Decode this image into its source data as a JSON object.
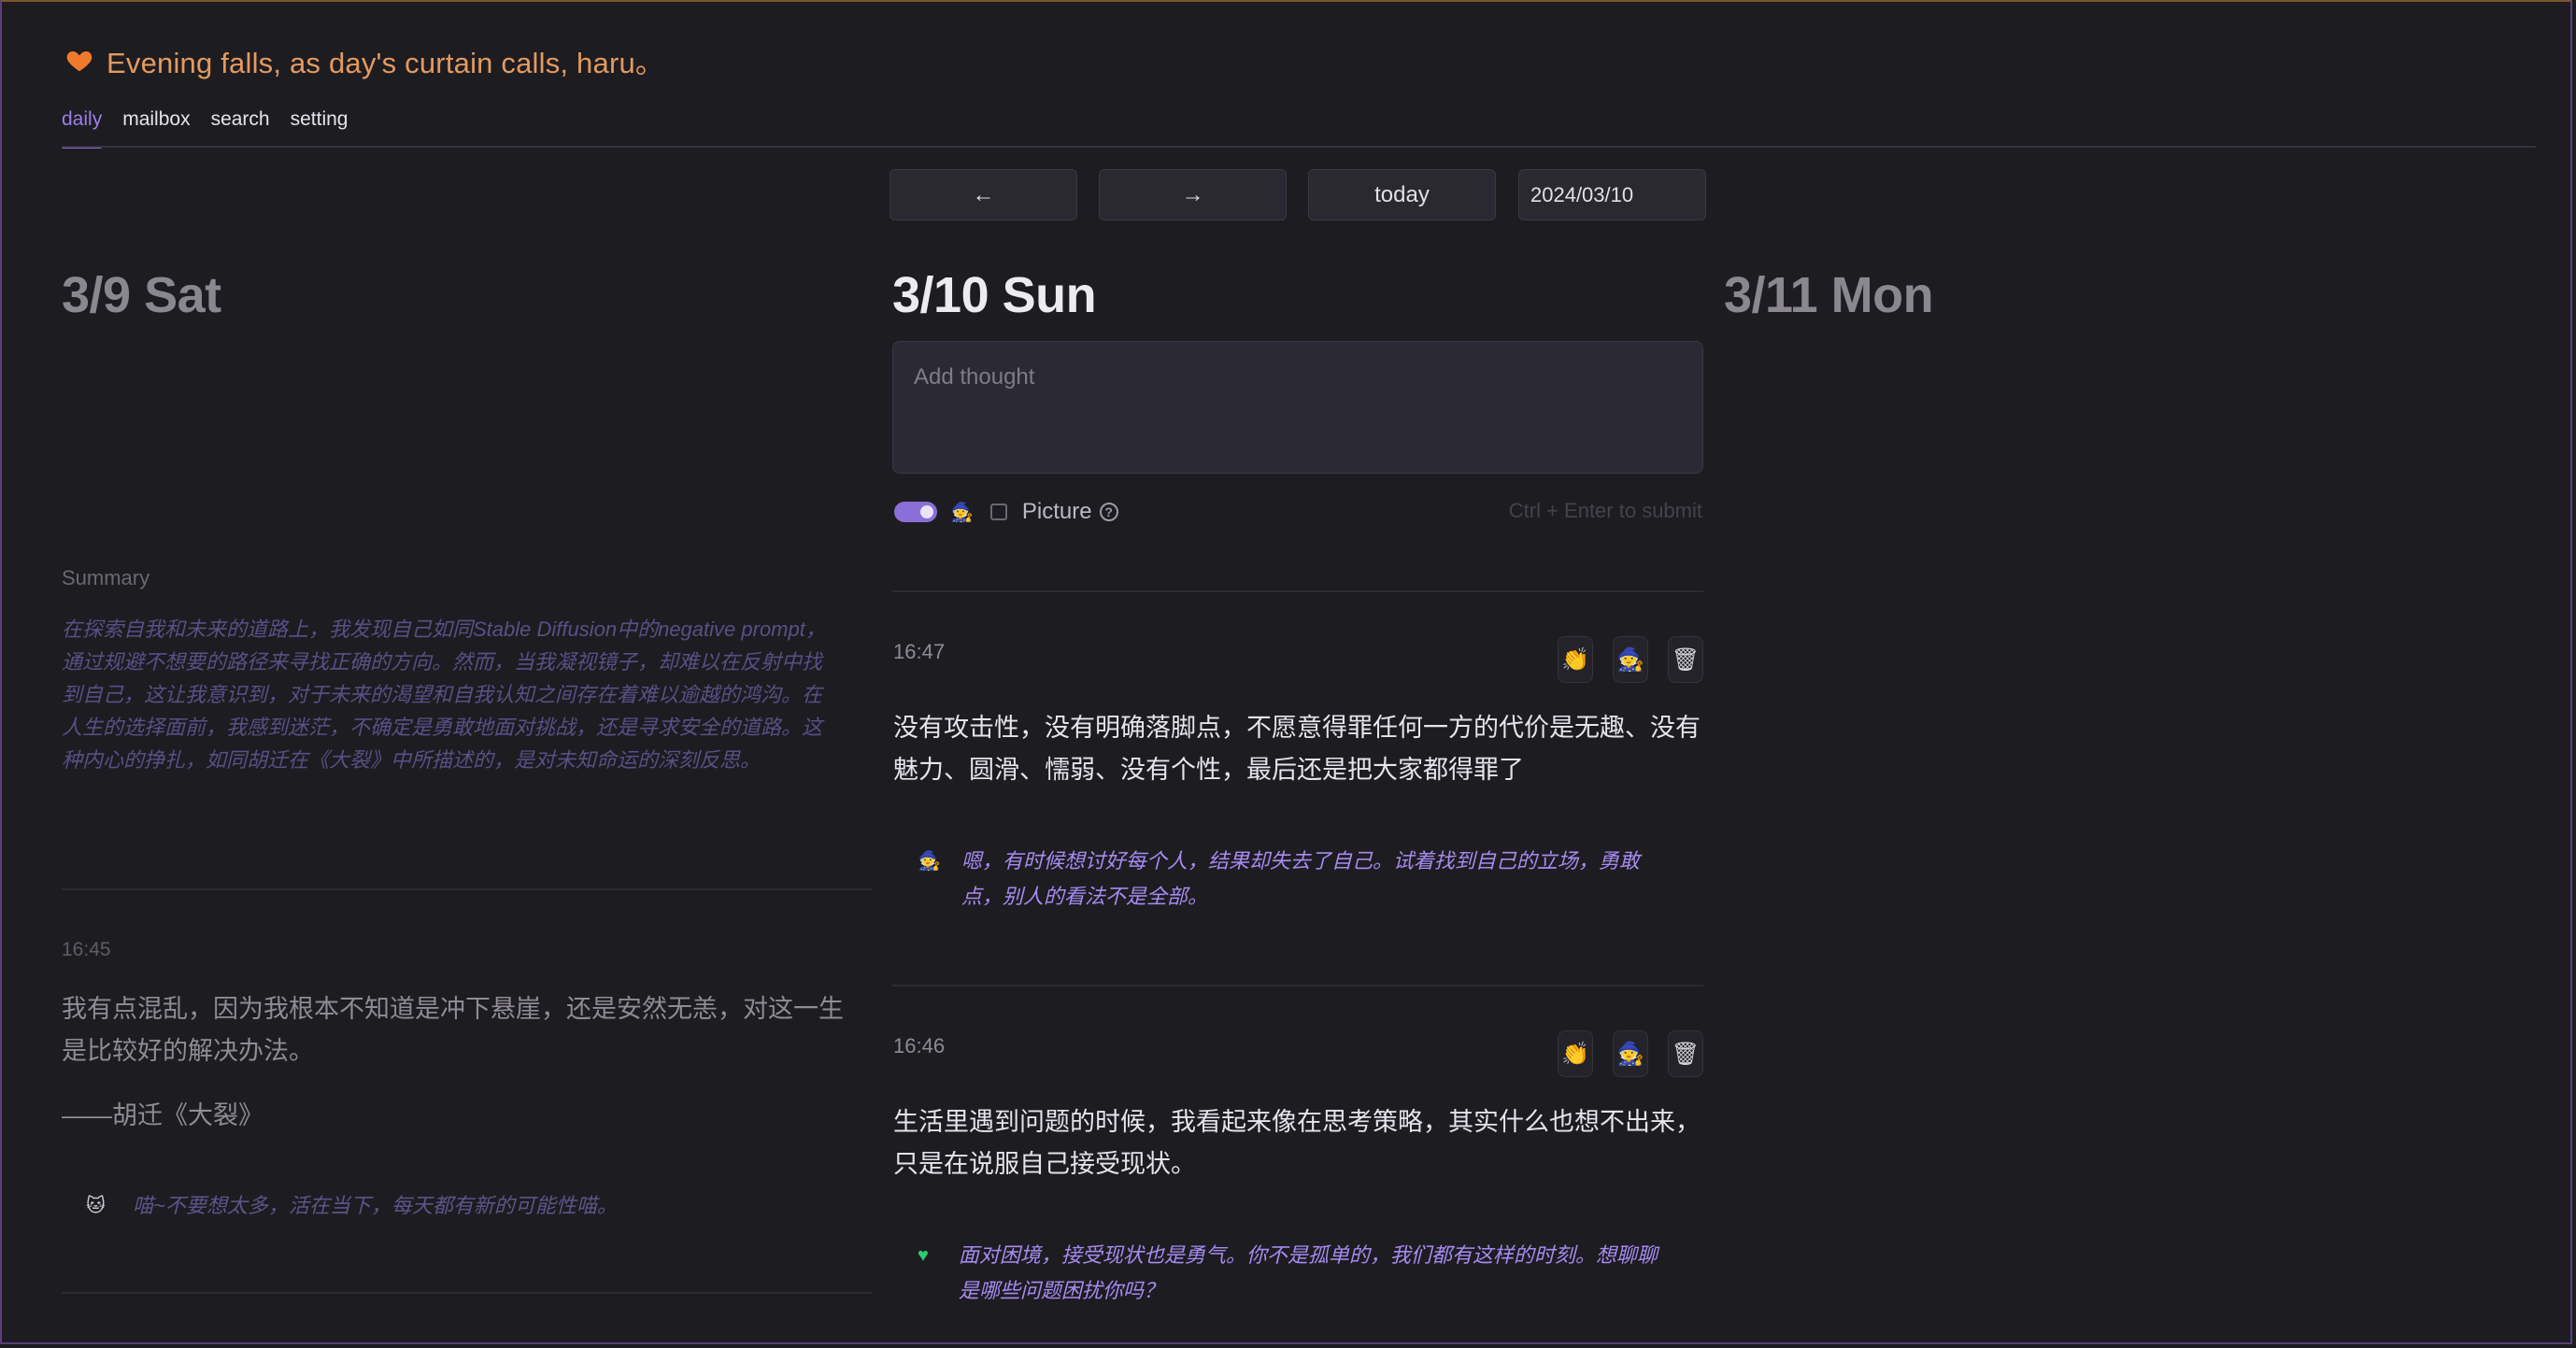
{
  "header": {
    "greeting": "Evening falls, as day's curtain calls, haru。",
    "icon": "heart-icon",
    "accent": "#e39a5e"
  },
  "tabs": [
    {
      "label": "daily",
      "active": true
    },
    {
      "label": "mailbox",
      "active": false
    },
    {
      "label": "search",
      "active": false
    },
    {
      "label": "setting",
      "active": false
    }
  ],
  "nav": {
    "prev": "←",
    "next": "→",
    "today": "today",
    "date_value": "2024/03/10"
  },
  "days": {
    "prev": {
      "title": "3/9 Sat",
      "summary_label": "Summary",
      "summary": "在探索自我和未来的道路上，我发现自己如同Stable Diffusion中的negative prompt，通过规避不想要的路径来寻找正确的方向。然而，当我凝视镜子，却难以在反射中找到自己，这让我意识到，对于未来的渴望和自我认知之间存在着难以逾越的鸿沟。在人生的选择面前，我感到迷茫，不确定是勇敢地面对挑战，还是寻求安全的道路。这种内心的挣扎，如同胡迁在《大裂》中所描述的，是对未知命运的深刻反思。",
      "entry": {
        "time": "16:45",
        "text": "我有点混乱，因为我根本不知道是冲下悬崖，还是安然无恙，对这一生是比较好的解决办法。",
        "quote": "——胡迁《大裂》",
        "reply_icon": "cat-icon",
        "reply": "喵~不要想太多，活在当下，每天都有新的可能性喵。"
      }
    },
    "current": {
      "title": "3/10 Sun",
      "input_placeholder": "Add thought",
      "toggle_on": true,
      "picture_label": "Picture",
      "submit_hint": "Ctrl + Enter to submit",
      "entries": [
        {
          "time": "16:47",
          "text": "没有攻击性，没有明确落脚点，不愿意得罪任何一方的代价是无趣、没有魅力、圆滑、懦弱、没有个性，最后还是把大家都得罪了",
          "reply_icon": "wizard-icon",
          "reply": "嗯，有时候想讨好每个人，结果却失去了自己。试着找到自己的立场，勇敢点，别人的看法不是全部。"
        },
        {
          "time": "16:46",
          "text": "生活里遇到问题的时候，我看起来像在思考策略，其实什么也想不出来，只是在说服自己接受现状。",
          "reply_icon": "green-heart-icon",
          "reply": "面对困境，接受现状也是勇气。你不是孤单的，我们都有这样的时刻。想聊聊是哪些问题困扰你吗？"
        }
      ]
    },
    "next": {
      "title": "3/11 Mon"
    }
  },
  "colors": {
    "accent_purple": "#8c6ddc",
    "background": "#1d1c21"
  }
}
